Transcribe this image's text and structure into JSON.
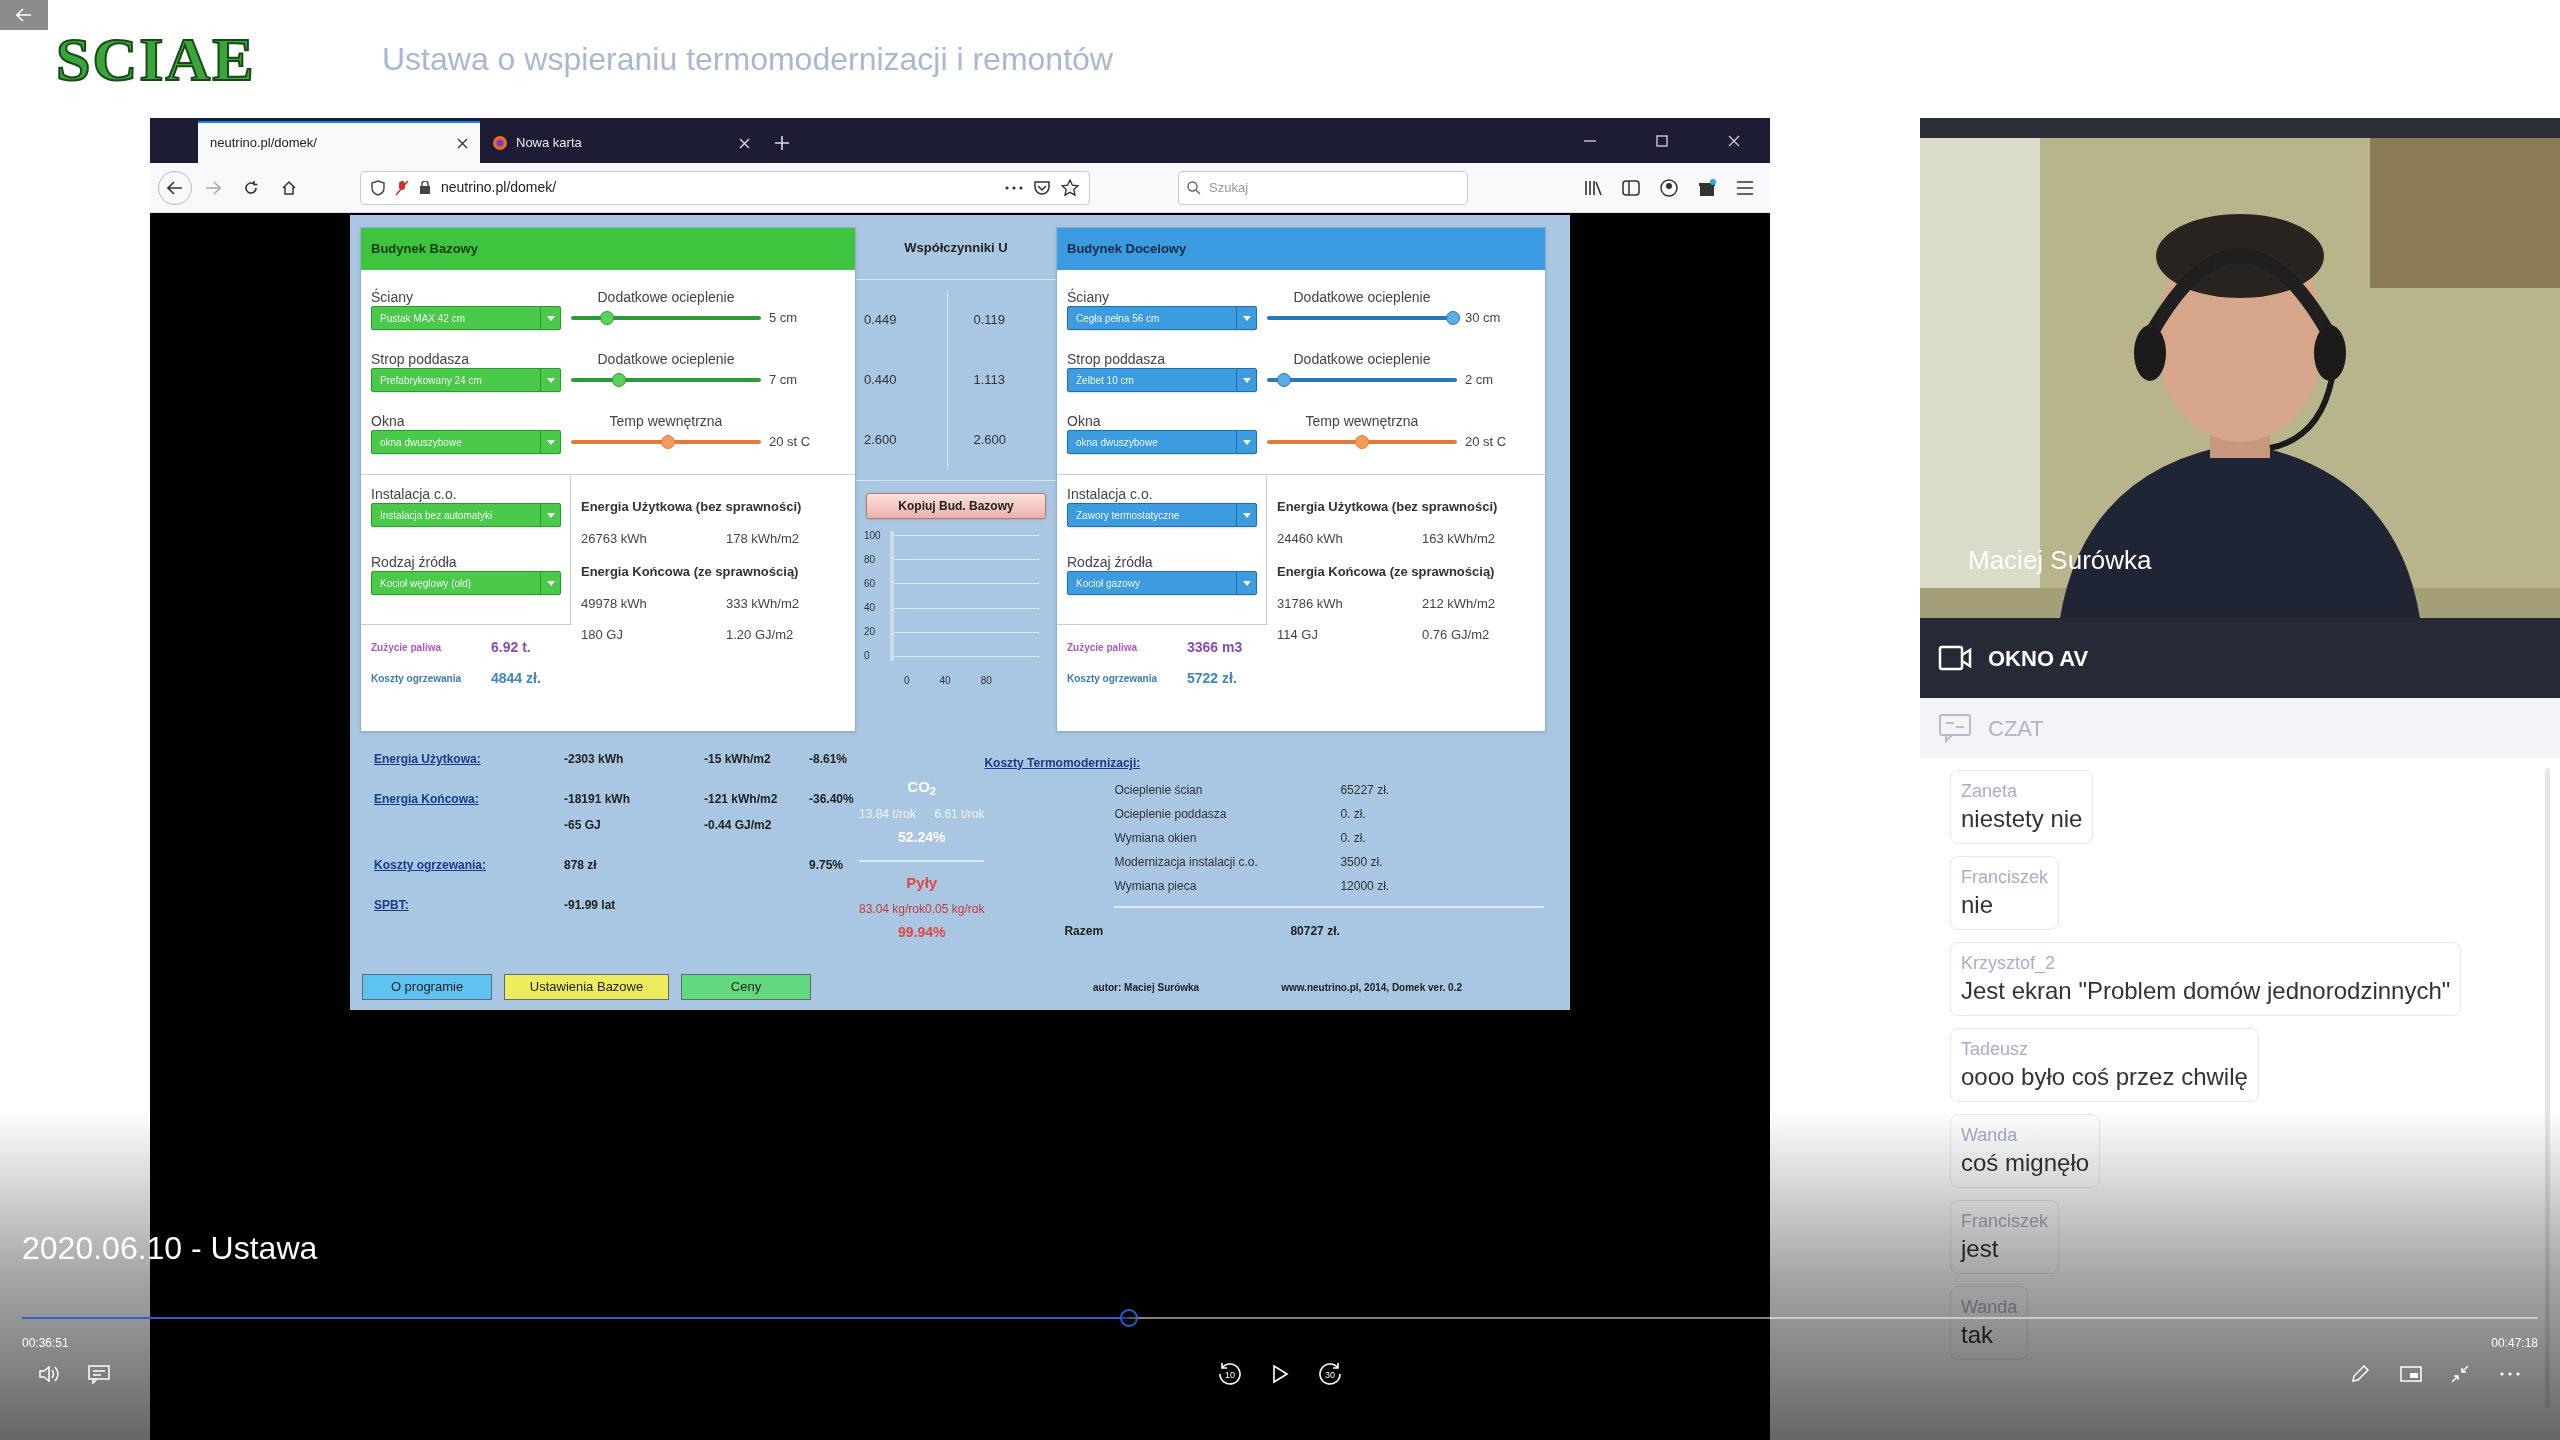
{
  "header": {
    "logo": "SCIAE",
    "title": "Ustawa o wspieraniu termomodernizacji i remontów"
  },
  "browser": {
    "tabs": [
      {
        "label": "neutrino.pl/domek/",
        "selected": true
      },
      {
        "label": "Nowa karta",
        "selected": false
      }
    ],
    "url": "neutrino.pl/domek/",
    "search": {
      "placeholder": "Szukaj"
    }
  },
  "app": {
    "cards": [
      {
        "kind": "base",
        "title": "Budynek Bazowy",
        "rows": [
          {
            "kind": "insulation",
            "label": "Ściany",
            "value": "Pustak MAX 42 cm",
            "slider_label": "Dodatkowe ocieplenie",
            "level": 0.19,
            "reading": "5 cm"
          },
          {
            "kind": "insulation",
            "label": "Strop poddasza",
            "value": "Prefabrykowany 24 cm",
            "slider_label": "Dodatkowe ocieplenie",
            "level": 0.25,
            "reading": "7 cm"
          },
          {
            "kind": "temperature",
            "label": "Okna",
            "value": "okna dwuszybowe",
            "slider_label": "Temp wewnętrzna",
            "level": 0.51,
            "reading": "20 st C"
          }
        ],
        "installation": {
          "label": "Instalacja c.o.",
          "value": "Instalacja bez automatyki"
        },
        "source": {
          "label": "Rodzaj źródła",
          "value": "Kocioł węglowy (old)"
        },
        "fuel": {
          "label": "Zużycie paliwa",
          "value": "6.92 t."
        },
        "cost": {
          "label": "Koszty ogrzewania",
          "value": "4844 zł."
        },
        "usable": {
          "title": "Energia Użytkowa (bez sprawności)",
          "values": [
            "26763 kWh",
            "178 kWh/m2"
          ]
        },
        "final": {
          "title": "Energia Końcowa (ze sprawnością)",
          "values": [
            "49978 kWh",
            "333 kWh/m2",
            "180 GJ",
            "1.20 GJ/m2"
          ]
        }
      },
      {
        "kind": "target",
        "title": "Budynek Docelowy",
        "rows": [
          {
            "kind": "insulation",
            "label": "Ściany",
            "value": "Cegła pełna 56 cm",
            "slider_label": "Dodatkowe ocieplenie",
            "level": 0.98,
            "reading": "30 cm"
          },
          {
            "kind": "insulation",
            "label": "Strop poddasza",
            "value": "Żelbet 10 cm",
            "slider_label": "Dodatkowe ocieplenie",
            "level": 0.09,
            "reading": "2 cm"
          },
          {
            "kind": "temperature",
            "label": "Okna",
            "value": "okna dwuszybowe",
            "slider_label": "Temp wewnętrzna",
            "level": 0.5,
            "reading": "20 st C"
          }
        ],
        "installation": {
          "label": "Instalacja c.o.",
          "value": "Zawory termostatyczne"
        },
        "source": {
          "label": "Rodzaj źródła",
          "value": "Kocioł gazowy"
        },
        "fuel": {
          "label": "Zużycie paliwa",
          "value": "3366 m3"
        },
        "cost": {
          "label": "Koszty ogrzewania",
          "value": "5722 zł."
        },
        "usable": {
          "title": "Energia Użytkowa (bez sprawności)",
          "values": [
            "24460 kWh",
            "163 kWh/m2"
          ]
        },
        "final": {
          "title": "Energia Końcowa (ze sprawnością)",
          "values": [
            "31786 kWh",
            "212 kWh/m2",
            "114 GJ",
            "0.76 GJ/m2"
          ]
        }
      }
    ],
    "u_values": {
      "title": "Współczynniki U",
      "rows": [
        [
          "0.449",
          "0.119"
        ],
        [
          "0.440",
          "1.113"
        ],
        [
          "2.600",
          "2.600"
        ]
      ]
    },
    "copy_button": "Kopiuj Bud. Bazowy",
    "mini_chart": {
      "y_ticks": [
        "100",
        "80",
        "60",
        "40",
        "20",
        "0"
      ],
      "x_ticks": [
        "0",
        "40",
        "80"
      ]
    },
    "summary": [
      {
        "label": "Energia Użytkowa:",
        "kwh": "-2303 kWh",
        "per_m2": "-15 kWh/m2",
        "percent": "-8.61%"
      },
      {
        "label": "Energia Końcowa:",
        "kwh": "-18191 kWh",
        "per_m2": "-121 kWh/m2",
        "percent": "-36.40%",
        "kwh_2": "-65 GJ",
        "per_m2_2": "-0.44 GJ/m2"
      },
      {
        "label": "Koszty ogrzewania:",
        "kwh": "878 zł",
        "percent": "9.75%"
      },
      {
        "label": "SPBT:",
        "kwh": "-91.99 lat"
      }
    ],
    "emissions": [
      {
        "kind": "co2",
        "label": "CO$_{2}$",
        "values": [
          "13.84 t/rok",
          "6.61 t/rok"
        ],
        "percent": "52.24%"
      },
      {
        "kind": "dust",
        "label": "Pyły",
        "values": [
          "83.04 kg/rok",
          "0.05 kg/rok"
        ],
        "percent": "99.94%"
      }
    ],
    "costs": {
      "title": "Koszty Termomodernizacji:",
      "items": [
        {
          "label": "Ocieplenie ścian",
          "value": "65227 zł."
        },
        {
          "label": "Ocieplenie poddasza",
          "value": "0. zł."
        },
        {
          "label": "Wymiana okien",
          "value": "0. zł."
        },
        {
          "label": "Modernizacja instalacji c.o.",
          "value": "3500 zł."
        },
        {
          "label": "Wymiana pieca",
          "value": "12000 zł."
        }
      ],
      "total_label": "Razem",
      "total": "80727 zł."
    },
    "buttons": [
      {
        "label": "O programie",
        "color": "#5fc3f2"
      },
      {
        "label": "Ustawienia Bazowe",
        "color": "#ecec5e"
      },
      {
        "label": "Ceny",
        "color": "#62d97e"
      }
    ],
    "author": "autor: Maciej Surówka",
    "site": "www.neutrino.pl, 2014, Domek ver. 0.2"
  },
  "side": {
    "camera": {
      "kind": "picture",
      "name": "Maciej Surówka"
    },
    "av_label": "OKNO AV",
    "chat_label": "CZAT",
    "messages": [
      {
        "author": "Zaneta",
        "text": "niestety nie"
      },
      {
        "author": "Franciszek",
        "text": "nie"
      },
      {
        "author": "Krzysztof_2",
        "text": "Jest ekran \"Problem domów jednorodzinnych\""
      },
      {
        "author": "Tadeusz",
        "text": "oooo było coś przez chwilę"
      },
      {
        "author": "Wanda",
        "text": "coś mignęło"
      },
      {
        "author": "Franciszek",
        "text": "jest"
      },
      {
        "author": "Wanda",
        "text": "tak"
      }
    ]
  },
  "video": {
    "title": "2020.06.10 - Ustawa",
    "elapsed": "00:36:51",
    "total": "00:47:18",
    "level": 0.44,
    "skip_back": "10",
    "skip_forward": "30"
  }
}
